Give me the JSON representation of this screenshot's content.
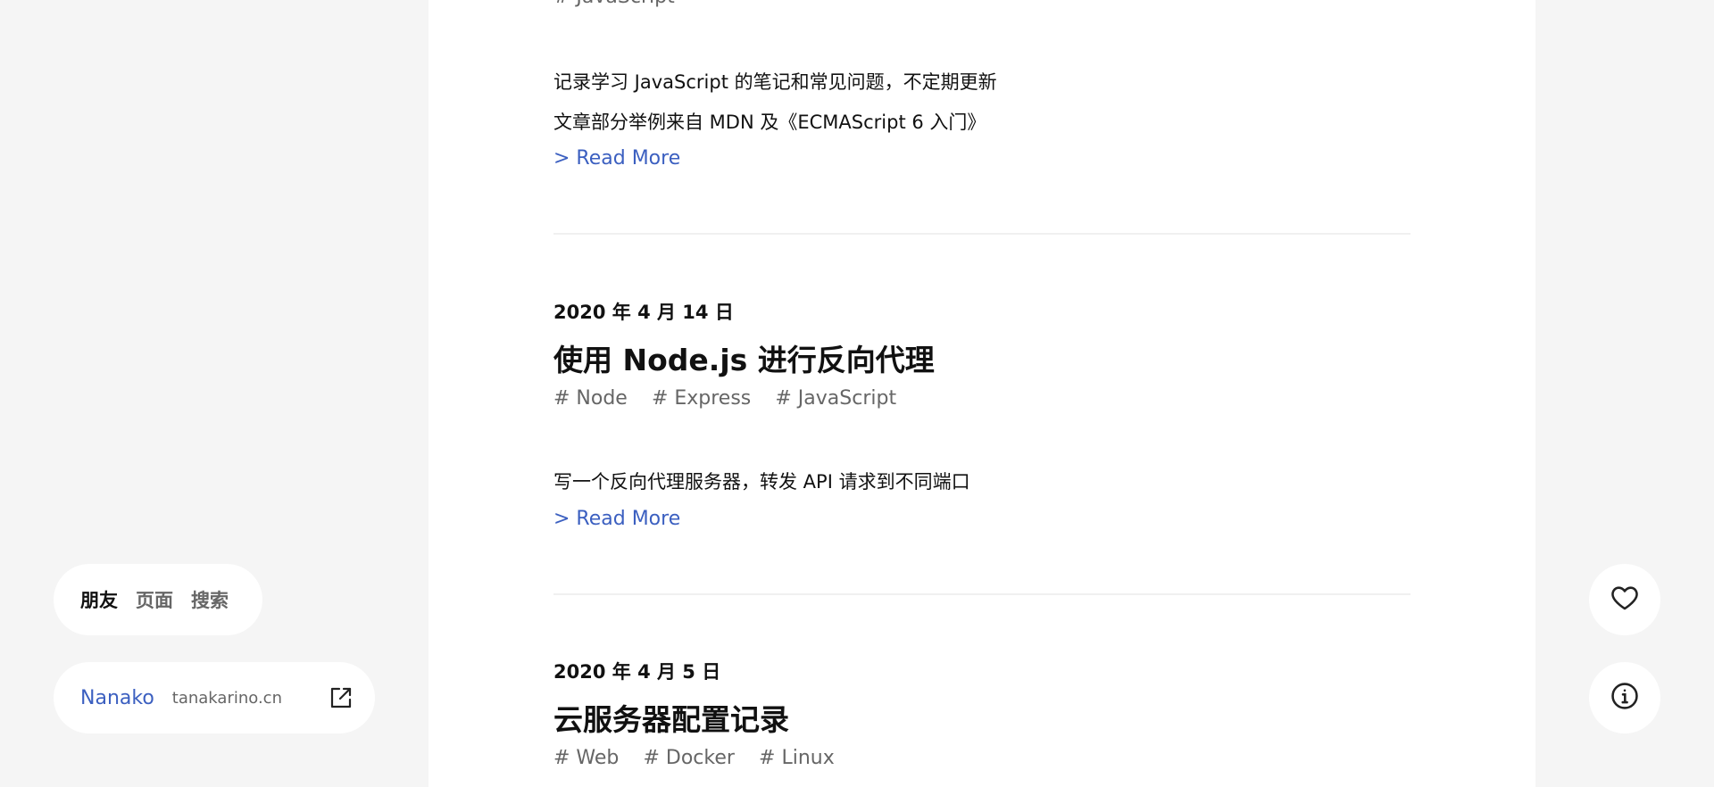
{
  "posts": [
    {
      "tags": [
        "# JavaScript"
      ],
      "excerpt": [
        "记录学习 JavaScript 的笔记和常见问题，不定期更新",
        "文章部分举例来自 MDN 及《ECMAScript 6 入门》"
      ],
      "read_more": "> Read More"
    },
    {
      "date": "2020 年 4 月 14 日",
      "title": "使用 Node.js 进行反向代理",
      "tags": [
        "# Node",
        "# Express",
        "# JavaScript"
      ],
      "excerpt": [
        "写一个反向代理服务器，转发 API 请求到不同端口"
      ],
      "read_more": "> Read More"
    },
    {
      "date": "2020 年 4 月 5 日",
      "title": "云服务器配置记录",
      "tags": [
        "# Web",
        "# Docker",
        "# Linux"
      ]
    }
  ],
  "nav": {
    "items": [
      "朋友",
      "页面",
      "搜索"
    ]
  },
  "friend": {
    "name": "Nanako",
    "url": "tanakarino.cn"
  },
  "icons": {
    "like": "heart-icon",
    "info": "info-icon",
    "external": "external-link-icon"
  },
  "colors": {
    "accent": "#3b5fc0",
    "background": "#f5f5f5",
    "card": "#ffffff"
  }
}
